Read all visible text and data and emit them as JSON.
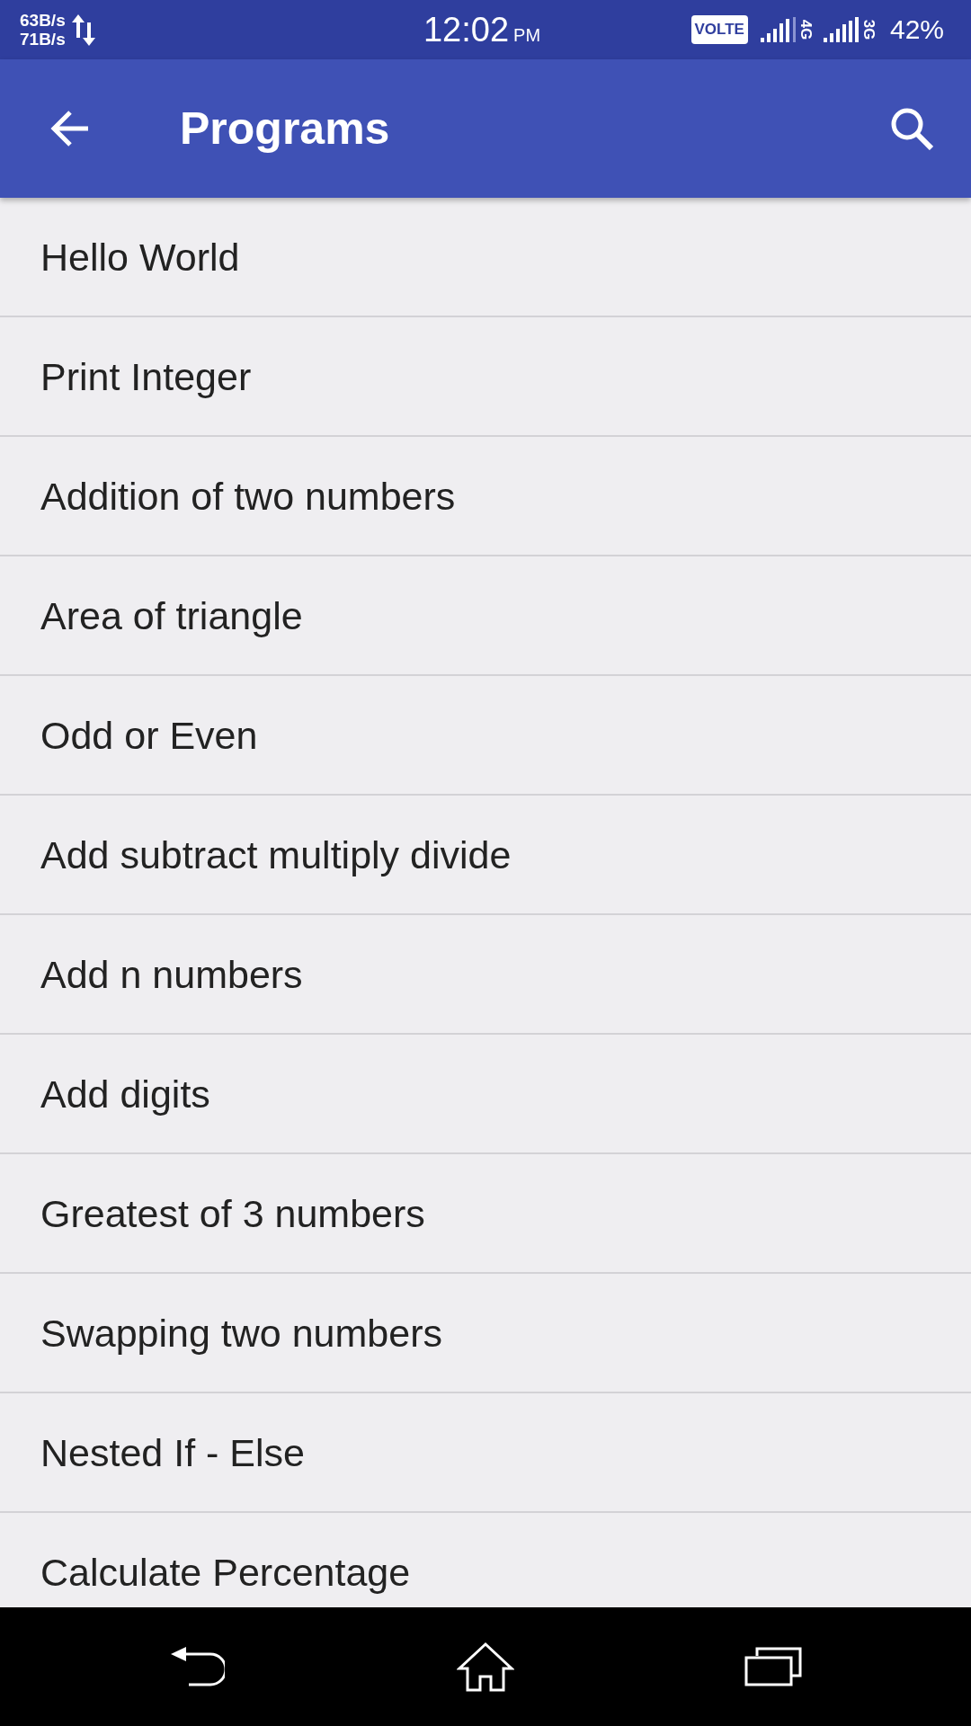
{
  "status_bar": {
    "upload_speed": "63B/s",
    "download_speed": "71B/s",
    "time": "12:02",
    "period": "PM",
    "volte": "VOLTE",
    "sim1_network": "4G",
    "sim2_network": "3G",
    "battery": "42%"
  },
  "app_bar": {
    "title": "Programs"
  },
  "programs": [
    "Hello World",
    "Print Integer",
    "Addition of two numbers",
    "Area of triangle",
    "Odd or Even",
    "Add subtract multiply divide",
    "Add n numbers",
    "Add digits",
    "Greatest of 3 numbers",
    "Swapping two numbers",
    "Nested If - Else",
    "Calculate Percentage"
  ]
}
